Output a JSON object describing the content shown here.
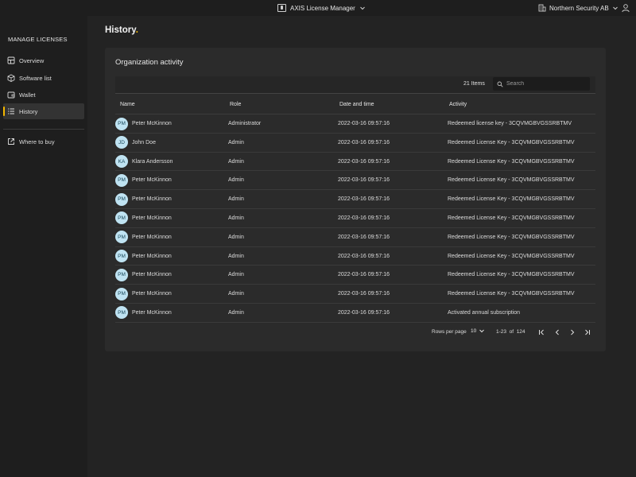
{
  "topbar": {
    "app_title": "AXIS License Manager",
    "org_name": "Northern Security AB"
  },
  "sidebar": {
    "heading": "MANAGE LICENSES",
    "items": [
      {
        "label": "Overview",
        "icon": "grid-icon"
      },
      {
        "label": "Software list",
        "icon": "box-icon"
      },
      {
        "label": "Wallet",
        "icon": "wallet-icon"
      },
      {
        "label": "History",
        "icon": "list-icon",
        "active": true
      }
    ],
    "external": {
      "label": "Where to buy",
      "icon": "external-link-icon"
    }
  },
  "page": {
    "title": "History",
    "title_suffix": "."
  },
  "card": {
    "title": "Organization activity",
    "items_count": "21 Items",
    "search_placeholder": "Search"
  },
  "table": {
    "columns": [
      "Name",
      "Role",
      "Date and time",
      "Activity"
    ],
    "rows": [
      {
        "initials": "PM",
        "name": "Peter McKinnon",
        "role": "Administrator",
        "date": "2022-03-16 09:57:16",
        "activity": "Redeemed license key - 3CQVMGBVGSSRBTMV"
      },
      {
        "initials": "JD",
        "name": "John Doe",
        "role": "Admin",
        "date": "2022-03-16 09:57:16",
        "activity": "Redeemed License Key - 3CQVMGBVGSSRBTMV"
      },
      {
        "initials": "KA",
        "name": "Klara Andersson",
        "role": "Admin",
        "date": "2022-03-16 09:57:16",
        "activity": "Redeemed License Key - 3CQVMGBVGSSRBTMV"
      },
      {
        "initials": "PM",
        "name": "Peter McKinnon",
        "role": "Admin",
        "date": "2022-03-16 09:57:16",
        "activity": "Redeemed License Key - 3CQVMGBVGSSRBTMV"
      },
      {
        "initials": "PM",
        "name": "Peter McKinnon",
        "role": "Admin",
        "date": "2022-03-16 09:57:16",
        "activity": "Redeemed License Key - 3CQVMGBVGSSRBTMV"
      },
      {
        "initials": "PM",
        "name": "Peter McKinnon",
        "role": "Admin",
        "date": "2022-03-16 09:57:16",
        "activity": "Redeemed License Key - 3CQVMGBVGSSRBTMV"
      },
      {
        "initials": "PM",
        "name": "Peter McKinnon",
        "role": "Admin",
        "date": "2022-03-16 09:57:16",
        "activity": "Redeemed License Key - 3CQVMGBVGSSRBTMV"
      },
      {
        "initials": "PM",
        "name": "Peter McKinnon",
        "role": "Admin",
        "date": "2022-03-16 09:57:16",
        "activity": "Redeemed License Key - 3CQVMGBVGSSRBTMV"
      },
      {
        "initials": "PM",
        "name": "Peter McKinnon",
        "role": "Admin",
        "date": "2022-03-16 09:57:16",
        "activity": "Redeemed License Key - 3CQVMGBVGSSRBTMV"
      },
      {
        "initials": "PM",
        "name": "Peter McKinnon",
        "role": "Admin",
        "date": "2022-03-16 09:57:16",
        "activity": "Redeemed License Key - 3CQVMGBVGSSRBTMV"
      },
      {
        "initials": "PM",
        "name": "Peter McKinnon",
        "role": "Admin",
        "date": "2022-03-16 09:57:16",
        "activity": "Activated annual subscription"
      }
    ]
  },
  "pagination": {
    "rows_per_page_label": "Rows per page",
    "rows_per_page": "10",
    "range": "1-23",
    "of_label": "of",
    "total": "124"
  },
  "colors": {
    "accent": "#f5b800",
    "avatar_bg": "#bfe3f2",
    "background": "#1e1e1e",
    "card": "#2b2b2b"
  }
}
